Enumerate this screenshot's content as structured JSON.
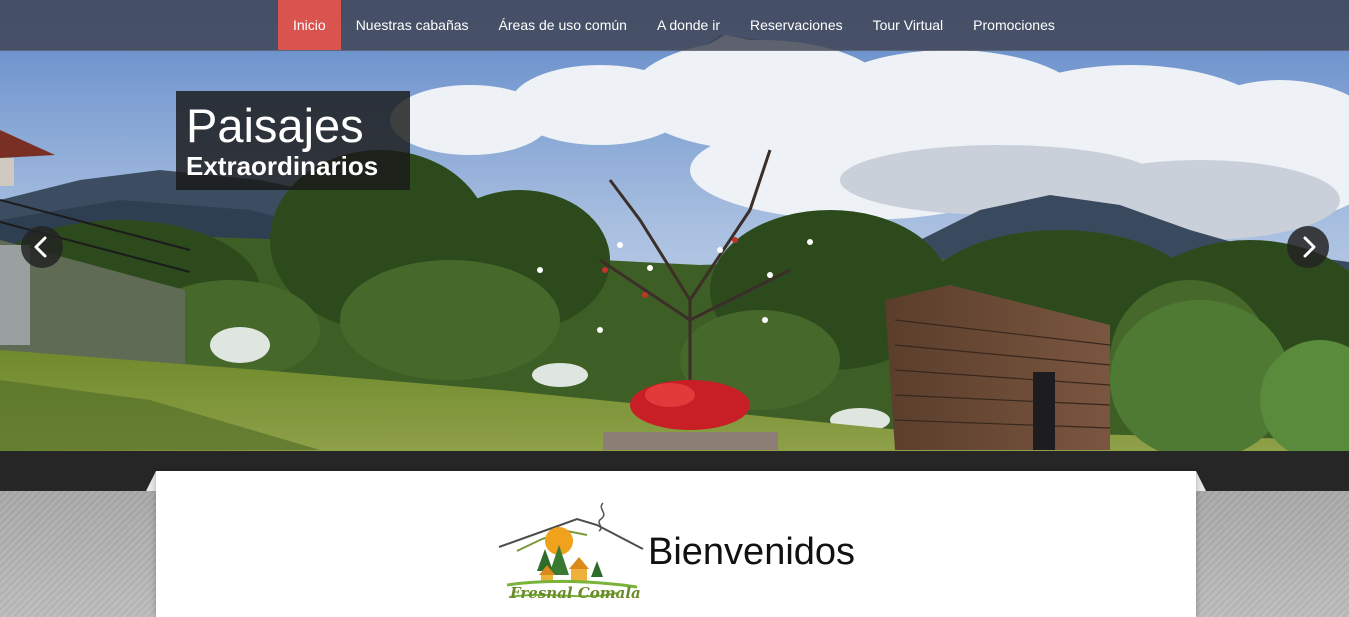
{
  "nav": {
    "items": [
      {
        "label": "Inicio",
        "active": true
      },
      {
        "label": "Nuestras cabañas",
        "active": false
      },
      {
        "label": "Áreas de uso común",
        "active": false
      },
      {
        "label": "A donde ir",
        "active": false
      },
      {
        "label": "Reservaciones",
        "active": false
      },
      {
        "label": "Tour Virtual",
        "active": false
      },
      {
        "label": "Promociones",
        "active": false
      }
    ],
    "active_color": "#d9534f"
  },
  "hero": {
    "caption_title": "Paisajes",
    "caption_subtitle": "Extraordinarios",
    "prev_icon": "chevron-left-icon",
    "next_icon": "chevron-right-icon"
  },
  "welcome": {
    "heading": "Bienvenidos",
    "logo_text": "Fresnal Comala"
  }
}
